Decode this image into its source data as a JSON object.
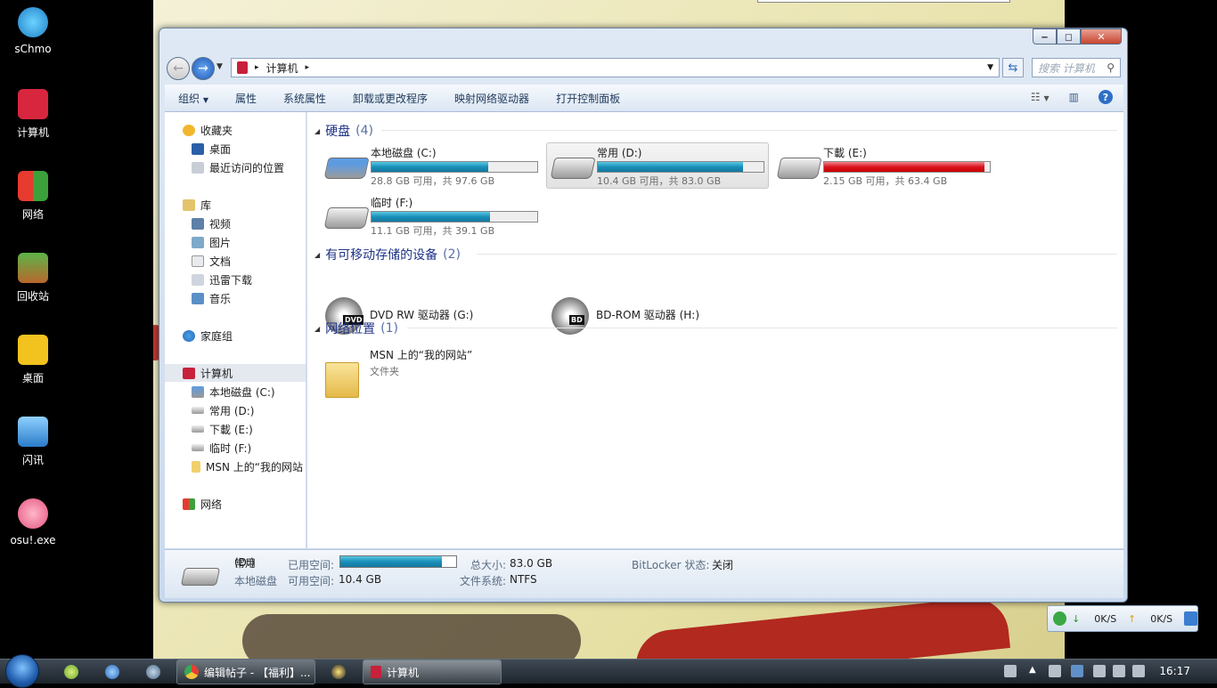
{
  "desktop": {
    "icons": [
      "sChmo",
      "计算机",
      "网络",
      "回收站",
      "桌面",
      "闪讯",
      "osu!.exe"
    ]
  },
  "window": {
    "address": "计算机",
    "search_placeholder": "搜索 计算机",
    "toolbar": [
      "组织",
      "属性",
      "系统属性",
      "卸载或更改程序",
      "映射网络驱动器",
      "打开控制面板"
    ],
    "nav": {
      "favorites": "收藏夹",
      "desktop": "桌面",
      "recent": "最近访问的位置",
      "libraries": "库",
      "videos": "视频",
      "pictures": "图片",
      "documents": "文档",
      "xunlei": "迅雷下载",
      "music": "音乐",
      "homegroup": "家庭组",
      "computer": "计算机",
      "drive_c": "本地磁盘 (C:)",
      "drive_d": "常用 (D:)",
      "drive_e": "下載 (E:)",
      "drive_f": "临时 (F:)",
      "msn": "MSN 上的“我的网站",
      "network": "网络"
    },
    "groups": {
      "hdd": "硬盘",
      "hdd_count": "(4)",
      "removable": "有可移动存储的设备",
      "removable_count": "(2)",
      "network": "网络位置",
      "network_count": "(1)"
    },
    "drives": [
      {
        "name": "本地磁盘 (C:)",
        "caption": "28.8 GB 可用，共 97.6 GB",
        "used_fraction": 0.705
      },
      {
        "name": "常用 (D:)",
        "caption": "10.4 GB 可用，共 83.0 GB",
        "used_fraction": 0.875
      },
      {
        "name": "下載 (E:)",
        "caption": "2.15 GB 可用，共 63.4 GB",
        "used_fraction": 0.966
      },
      {
        "name": "临时 (F:)",
        "caption": "11.1 GB 可用，共 39.1 GB",
        "used_fraction": 0.716
      }
    ],
    "devices": [
      {
        "name": "DVD RW 驱动器 (G:)",
        "tag": "DVD"
      },
      {
        "name": "BD-ROM 驱动器 (H:)",
        "tag": "BD"
      }
    ],
    "network_item": {
      "name": "MSN 上的“我的网站”",
      "type": "文件夹"
    },
    "details": {
      "title": "常用",
      "title_suffix": "(D:)",
      "type": "本地磁盘",
      "used_label": "已用空间:",
      "used_fraction": 0.875,
      "free_label": "可用空间:",
      "free_value": "10.4 GB",
      "total_label": "总大小:",
      "total_value": "83.0 GB",
      "fs_label": "文件系统:",
      "fs_value": "NTFS",
      "bitlocker_label": "BitLocker 状态:",
      "bitlocker_value": "关闭"
    }
  },
  "netspeed": {
    "down": "0K/S",
    "up": "0K/S"
  },
  "taskbar": {
    "tasks": [
      "编辑帖子 - 【福利】...",
      "计算机"
    ],
    "clock": "16:17"
  }
}
